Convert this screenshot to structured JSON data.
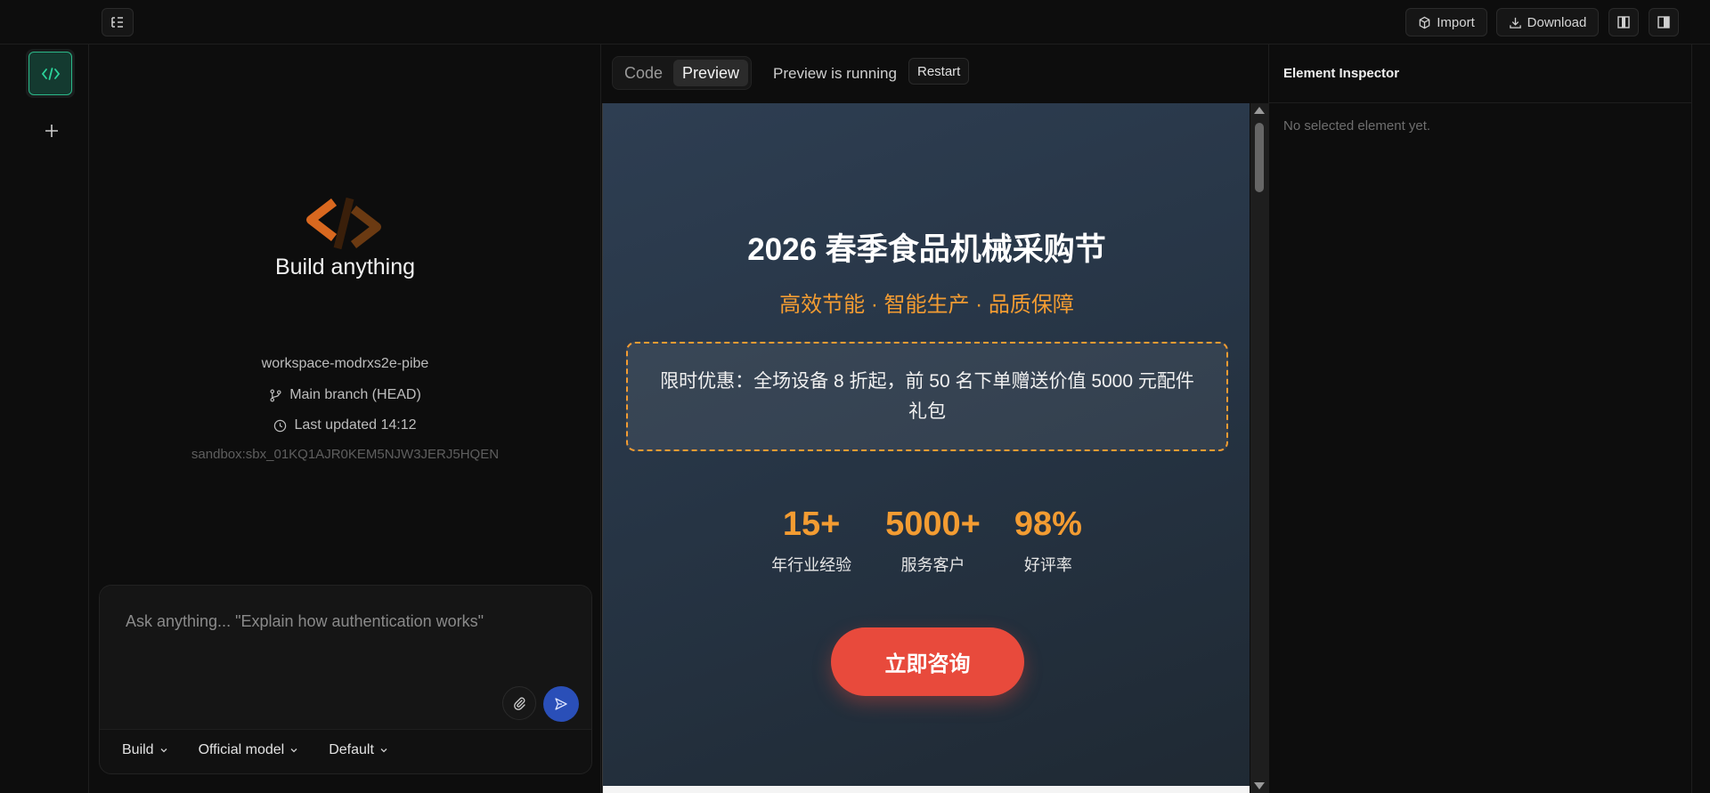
{
  "topbar": {
    "import_label": "Import",
    "download_label": "Download"
  },
  "chat": {
    "title": "Build anything",
    "workspace": "workspace-modrxs2e-pibe",
    "branch": "Main branch (HEAD)",
    "updated": "Last updated 14:12",
    "sandbox": "sandbox:sbx_01KQ1AJR0KEM5NJW3JERJ5HQEN",
    "placeholder": "Ask anything... \"Explain how authentication works\"",
    "options": [
      "Build",
      "Official model",
      "Default"
    ]
  },
  "preview": {
    "tabs": [
      "Code",
      "Preview"
    ],
    "active_tab": "Preview",
    "status": "Preview is running",
    "restart_label": "Restart"
  },
  "site": {
    "title": "2026 春季食品机械采购节",
    "subtitle": "高效节能 · 智能生产 · 品质保障",
    "promo": "限时优惠：全场设备 8 折起，前 50 名下单赠送价值 5000 元配件礼包",
    "stats": [
      {
        "num": "15+",
        "label": "年行业经验"
      },
      {
        "num": "5000+",
        "label": "服务客户"
      },
      {
        "num": "98%",
        "label": "好评率"
      }
    ],
    "cta": "立即咨询"
  },
  "inspector": {
    "title": "Element Inspector",
    "empty": "No selected element yet."
  },
  "colors": {
    "accent_orange": "#f39c32",
    "cta_red": "#e84a3c",
    "send_blue": "#2a4fb8",
    "active_green": "#2bb889"
  }
}
